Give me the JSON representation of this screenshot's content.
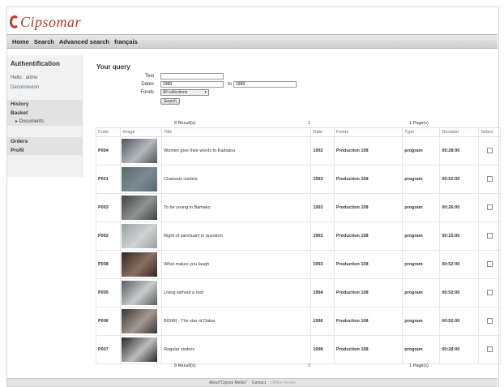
{
  "app": {
    "logo_text": "Cipsomar"
  },
  "menu": [
    "Home",
    "Search",
    "Advanced search",
    "français"
  ],
  "sidebar": {
    "auth_title": "Authentification",
    "hello": "Hello : atimo",
    "disconnect": "Deconnexion",
    "items": [
      "History",
      "Basket"
    ],
    "sub_item": "Documents",
    "items2": [
      "Orders",
      "Profil"
    ]
  },
  "query": {
    "title": "Your query",
    "text_label": "Text",
    "text_value": "",
    "dates_label": "Dates",
    "date_from": "1990",
    "to_label": "to",
    "date_to": "1999",
    "fonds_label": "Fonds",
    "fonds_value": "All collections",
    "search_label": "Search"
  },
  "pager": {
    "results": "8 Result(s)",
    "arrow": "1",
    "pages": "1 Page(s)"
  },
  "table": {
    "headers": [
      "Code",
      "Image",
      "Title",
      "Date",
      "Fonds",
      "Type",
      "Duration",
      "Select"
    ],
    "rows": [
      {
        "code": "P004",
        "title": "Women give their words to Kadiatou",
        "date": "1992",
        "fonds": "Production 108",
        "type": "program",
        "duration": "00:28:00",
        "c1": "#4d5560",
        "c2": "#b4b9ba"
      },
      {
        "code": "P001",
        "title": "Chasseis conteis",
        "date": "1993",
        "fonds": "Production 108",
        "type": "program",
        "duration": "00:52:00",
        "c1": "#5c6870",
        "c2": "#7b8a92"
      },
      {
        "code": "P003",
        "title": "To be young in Bamako",
        "date": "1993",
        "fonds": "Production 108",
        "type": "program",
        "duration": "00:26:00",
        "c1": "#3d4342",
        "c2": "#8f9490"
      },
      {
        "code": "P002",
        "title": "Right of sanctuary in question",
        "date": "1993",
        "fonds": "Production 108",
        "type": "program",
        "duration": "00:15:00",
        "c1": "#9aa0a2",
        "c2": "#cfd2d2"
      },
      {
        "code": "P008",
        "title": "What makes you laugh",
        "date": "1993",
        "fonds": "Production 108",
        "type": "program",
        "duration": "00:52:00",
        "c1": "#2f2826",
        "c2": "#8a6f60"
      },
      {
        "code": "P005",
        "title": "Living without a roof",
        "date": "1994",
        "fonds": "Production 108",
        "type": "program",
        "duration": "00:52:00",
        "c1": "#5a5e5e",
        "c2": "#c9cccc"
      },
      {
        "code": "P006",
        "title": "BIDIRI - The star of Dakar",
        "date": "1996",
        "fonds": "Production 108",
        "type": "program",
        "duration": "00:52:00",
        "c1": "#3c3433",
        "c2": "#a4998f"
      },
      {
        "code": "P007",
        "title": "Regular visitors",
        "date": "1998",
        "fonds": "Production 108",
        "type": "program",
        "duration": "00:28:00",
        "c1": "#262626",
        "c2": "#bdbdbd"
      }
    ]
  },
  "footer": {
    "about": "About\"Cipsos Media\"",
    "contact": "Contact",
    "extra": "Offline Viewer"
  }
}
